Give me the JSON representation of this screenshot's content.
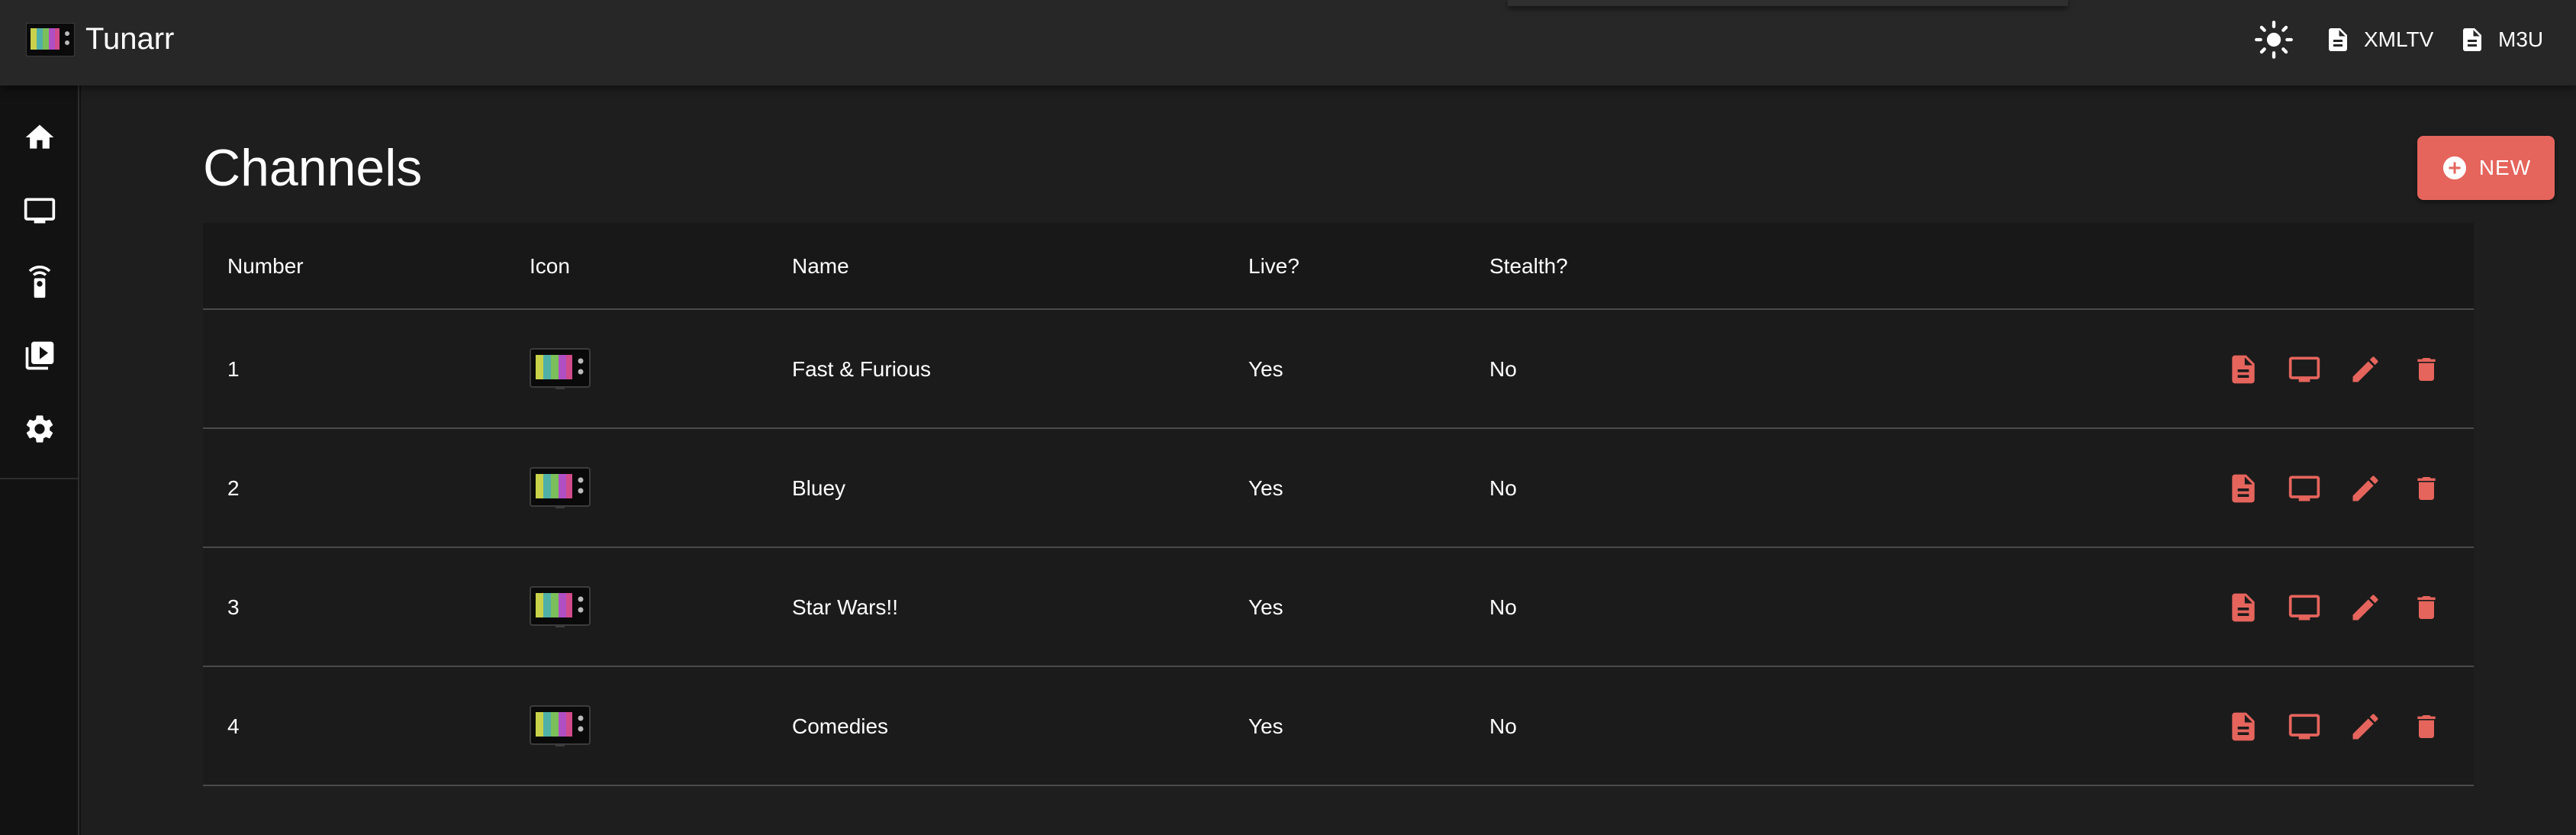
{
  "app": {
    "title": "Tunarr"
  },
  "header": {
    "xmltv_label": "XMLTV",
    "m3u_label": "M3U",
    "theme_icon": "brightness-icon"
  },
  "sidebar": {
    "items": [
      {
        "icon": "home-icon"
      },
      {
        "icon": "tv-icon"
      },
      {
        "icon": "remote-icon"
      },
      {
        "icon": "video-library-icon"
      },
      {
        "icon": "gear-icon"
      }
    ]
  },
  "page": {
    "title": "Channels",
    "new_button_label": "NEW"
  },
  "table": {
    "columns": [
      "Number",
      "Icon",
      "Name",
      "Live?",
      "Stealth?"
    ],
    "rows": [
      {
        "number": "1",
        "name": "Fast & Furious",
        "live": "Yes",
        "stealth": "No"
      },
      {
        "number": "2",
        "name": "Bluey",
        "live": "Yes",
        "stealth": "No"
      },
      {
        "number": "3",
        "name": "Star Wars!!",
        "live": "Yes",
        "stealth": "No"
      },
      {
        "number": "4",
        "name": "Comedies",
        "live": "Yes",
        "stealth": "No"
      }
    ],
    "row_actions": [
      "guide-icon",
      "watch-tv-icon",
      "edit-icon",
      "delete-icon"
    ]
  },
  "colors": {
    "accent": "#e5645c",
    "appbar": "#272727",
    "background": "#1e1e1e",
    "drawer": "#121212"
  }
}
